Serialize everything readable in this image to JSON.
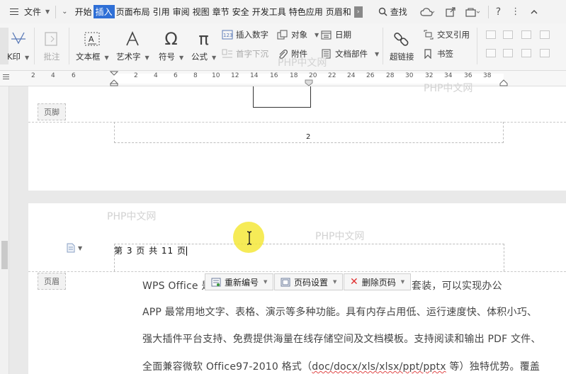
{
  "menubar": {
    "file_label": "文件",
    "tabs": [
      "开始",
      "插入",
      "页面布局",
      "引用",
      "审阅",
      "视图",
      "章节",
      "安全",
      "开发工具",
      "特色应用",
      "页眉和"
    ],
    "active_tab": "插入",
    "find_label": "查找"
  },
  "ribbon": {
    "partial_label": "K印",
    "batch_comment": "批注",
    "textbox": "文本框",
    "wordart": "艺术字",
    "symbol": "符号",
    "formula": "公式",
    "insert_number": "插入数字",
    "dropcap": "首字下沉",
    "object": "对象",
    "attachment": "附件",
    "date": "日期",
    "doc_parts": "文档部件",
    "hyperlink": "超链接",
    "cross_ref": "交叉引用",
    "bookmark": "书签"
  },
  "ruler": {
    "labels": [
      "6",
      "4",
      "2",
      "2",
      "4",
      "6",
      "8",
      "10",
      "12",
      "14",
      "16",
      "18",
      "20",
      "22",
      "24",
      "26",
      "28",
      "30",
      "32",
      "34",
      "36",
      "38"
    ]
  },
  "page1": {
    "footer_tag": "页脚",
    "page_number": "2"
  },
  "page2": {
    "header_tag": "页眉",
    "header_text": "第 3 页 共 11 页",
    "body_lines": [
      "WPS Office 是由金山软件公司自主研发的一款办公软件套装，可以实现办公",
      "APP 最常用地文字、表格、演示等多种功能。具有内存占用低、运行速度快、体积小巧、",
      "强大插件平台支持、免费提供海量在线存储空间及文档模板。支持阅读和输出 PDF 文件、",
      "全面兼容微软 Office97-2010 格式（doc/docx/xls/xlsx/ppt/pptx 等）独特优势。覆盖"
    ],
    "line1_visible_start": "WPS Office 是由金山",
    "line1_visible_end": "套装，可以实现办公"
  },
  "popup": {
    "renumber": "重新编号",
    "page_setup": "页码设置",
    "delete_number": "删除页码"
  },
  "watermark": "PHP中文网",
  "colors": {
    "active_tab_bg": "#2f6fd6",
    "cursor_highlight": "#f4e73a",
    "delete_icon": "#e03030"
  }
}
